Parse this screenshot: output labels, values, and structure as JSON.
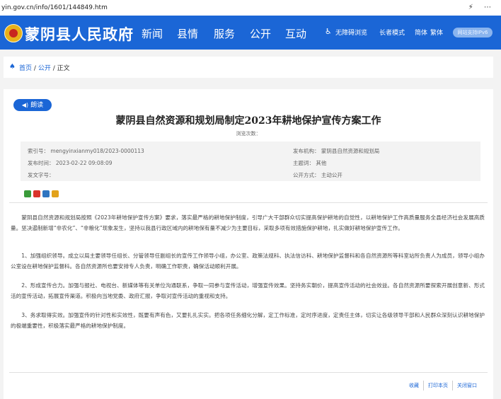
{
  "browser": {
    "url": "yin.gov.cn/info/1601/144849.htm",
    "controls": "⚡ ⋯"
  },
  "header": {
    "site_title": "蒙阴县人民政府",
    "nav": [
      "新闻",
      "县情",
      "服务",
      "公开",
      "互动"
    ],
    "tools": {
      "accessible": "无障碍浏览",
      "elder": "长者模式",
      "simplified": "简体",
      "traditional": "繁体",
      "ipv6": "网站支持IPv6"
    }
  },
  "breadcrumb": {
    "home": "首页",
    "sep": "/",
    "section": "公开",
    "current": "正文"
  },
  "article": {
    "read_aloud": "朗读",
    "title": "蒙阴县自然资源和规划局制定2023年耕地保护宣传方案工作",
    "views_label": "浏览次数：",
    "meta": {
      "index_label": "索引号：",
      "index_value": "mengyinxianmy018/2023-0000113",
      "date_label": "发布时间：",
      "date_value": "2023-02-22 09:08:09",
      "docno_label": "发文字号：",
      "docno_value": "",
      "org_label": "发布机构：",
      "org_value": "蒙阴县自然资源和规划局",
      "topic_label": "主题词：",
      "topic_value": "其他",
      "mode_label": "公开方式：",
      "mode_value": "主动公开"
    },
    "share_colors": [
      "#3a9b3a",
      "#d9342b",
      "#2f74c0",
      "#e2a21a"
    ],
    "paragraphs": [
      "蒙阴县自然资源和规划局按照《2023年耕地保护宣传方案》要求，落实最严格的耕地保护制度，引导广大干部群众切实提高保护耕地的自觉性，以耕地保护工作高质量服务全县经济社会发展高质量。坚决遏制新增“非农化”、“非粮化”现象发生，坚持以我县行政区域内的耕地保有量不减少为主要目标，采取多项有效措施保护耕地，扎实做好耕地保护宣传工作。",
      "1、加强组织领导。成立以局主要领导任组长、分管领导任副组长的宣传工作领导小组，办公室、政策法规科、执法信访科、耕地保护监督科和各自然资源所等科室站所负责人为成员，领导小组办公室设在耕地保护监督科。各自然资源所也要安排专人负责，明确工作职责，确保活动顺利开展。",
      "2、形成宣传合力。加强与报社、电视台、新媒体等有关单位沟通联系，争取一同参与宣传活动，增强宣传效果。坚持务实朝价，提高宣传活动的社会效益。各自然资源所要探索开展创意新、形式活的宣传活动，拓展宣传渠道。积极向当地党委、政府汇报，争取对宣传活动的重视和支持。",
      "3、务求取得实效。加强宣传的针对性和实效性，既要有声有色，又要扎扎实实。把各项任务细化分解，定工作标准，定时序进度，定责任主体，切实让各级领导干部和人民群众深刻认识耕地保护的极端重要性，积极落实最严格的耕地保护制度。"
    ],
    "bottom": {
      "favorite": "收藏",
      "print": "打印本页",
      "close": "关闭窗口"
    }
  }
}
